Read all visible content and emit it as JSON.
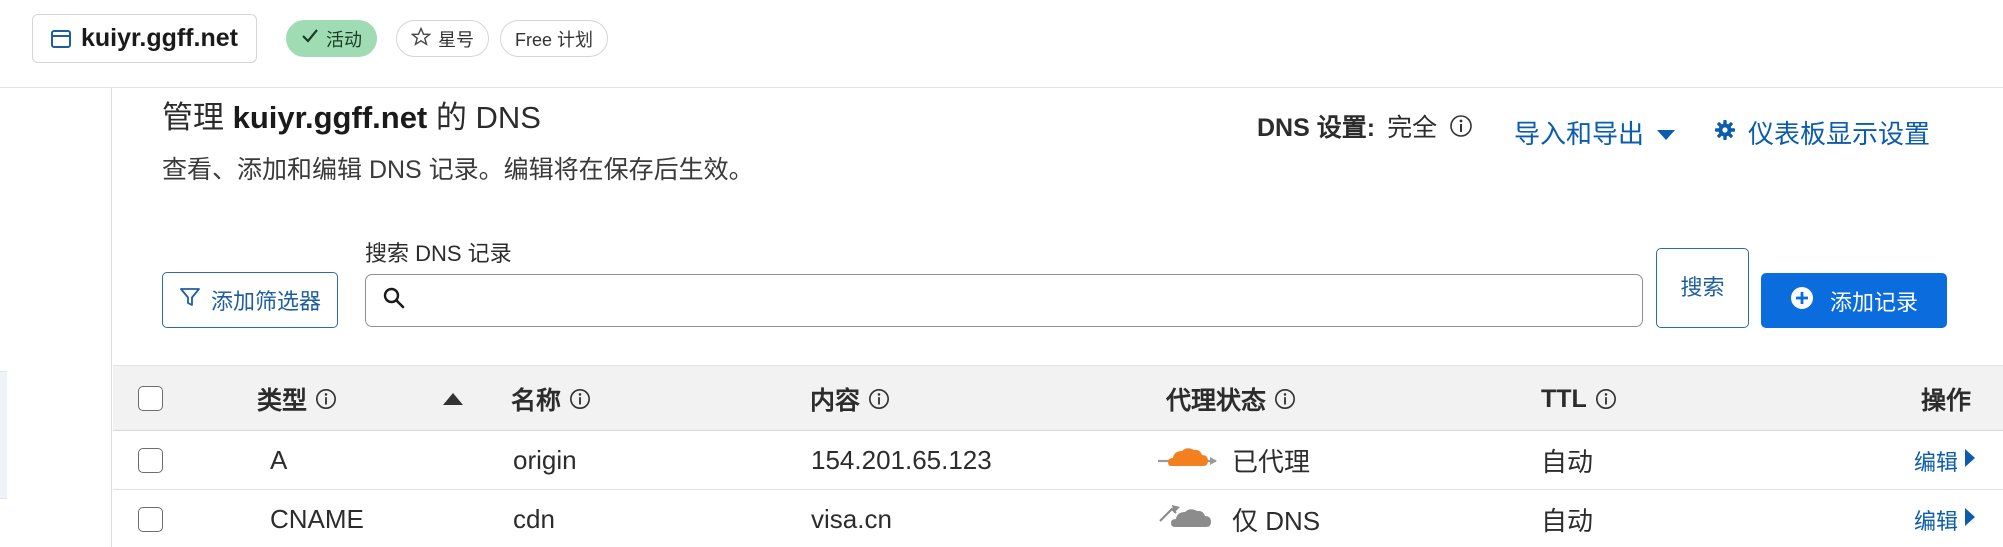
{
  "header": {
    "zone_name": "kuiyr.ggff.net",
    "badges": {
      "active": "活动",
      "star": "星号",
      "plan": "Free 计划"
    }
  },
  "page": {
    "title_prefix": "管理",
    "title_zone": "kuiyr.ggff.net",
    "title_suffix": "的 DNS",
    "subtitle": "查看、添加和编辑 DNS 记录。编辑将在保存后生效。",
    "dns_setting_label": "DNS 设置:",
    "dns_setting_value": "完全",
    "import_export": "导入和导出",
    "dashboard_settings": "仪表板显示设置"
  },
  "toolbar": {
    "filter_label": "添加筛选器",
    "search_label": "搜索 DNS 记录",
    "search_value": "",
    "search_button": "搜索",
    "add_record": "添加记录"
  },
  "table": {
    "columns": {
      "type": "类型",
      "name": "名称",
      "content": "内容",
      "proxy": "代理状态",
      "ttl": "TTL",
      "actions": "操作"
    },
    "rows": [
      {
        "type": "A",
        "name": "origin",
        "content": "154.201.65.123",
        "proxy": "已代理",
        "proxy_icon": "orange-cloud-icon",
        "ttl": "自动",
        "edit": "编辑"
      },
      {
        "type": "CNAME",
        "name": "cdn",
        "content": "visa.cn",
        "proxy": "仅 DNS",
        "proxy_icon": "grey-cloud-icon",
        "ttl": "自动",
        "edit": "编辑"
      }
    ]
  },
  "colors": {
    "accent": "#0a6cdd",
    "link": "#0b5cad",
    "active_badge": "#9fdbb3",
    "proxied_cloud": "#f38020",
    "dns_only_cloud": "#8c8c8c"
  }
}
